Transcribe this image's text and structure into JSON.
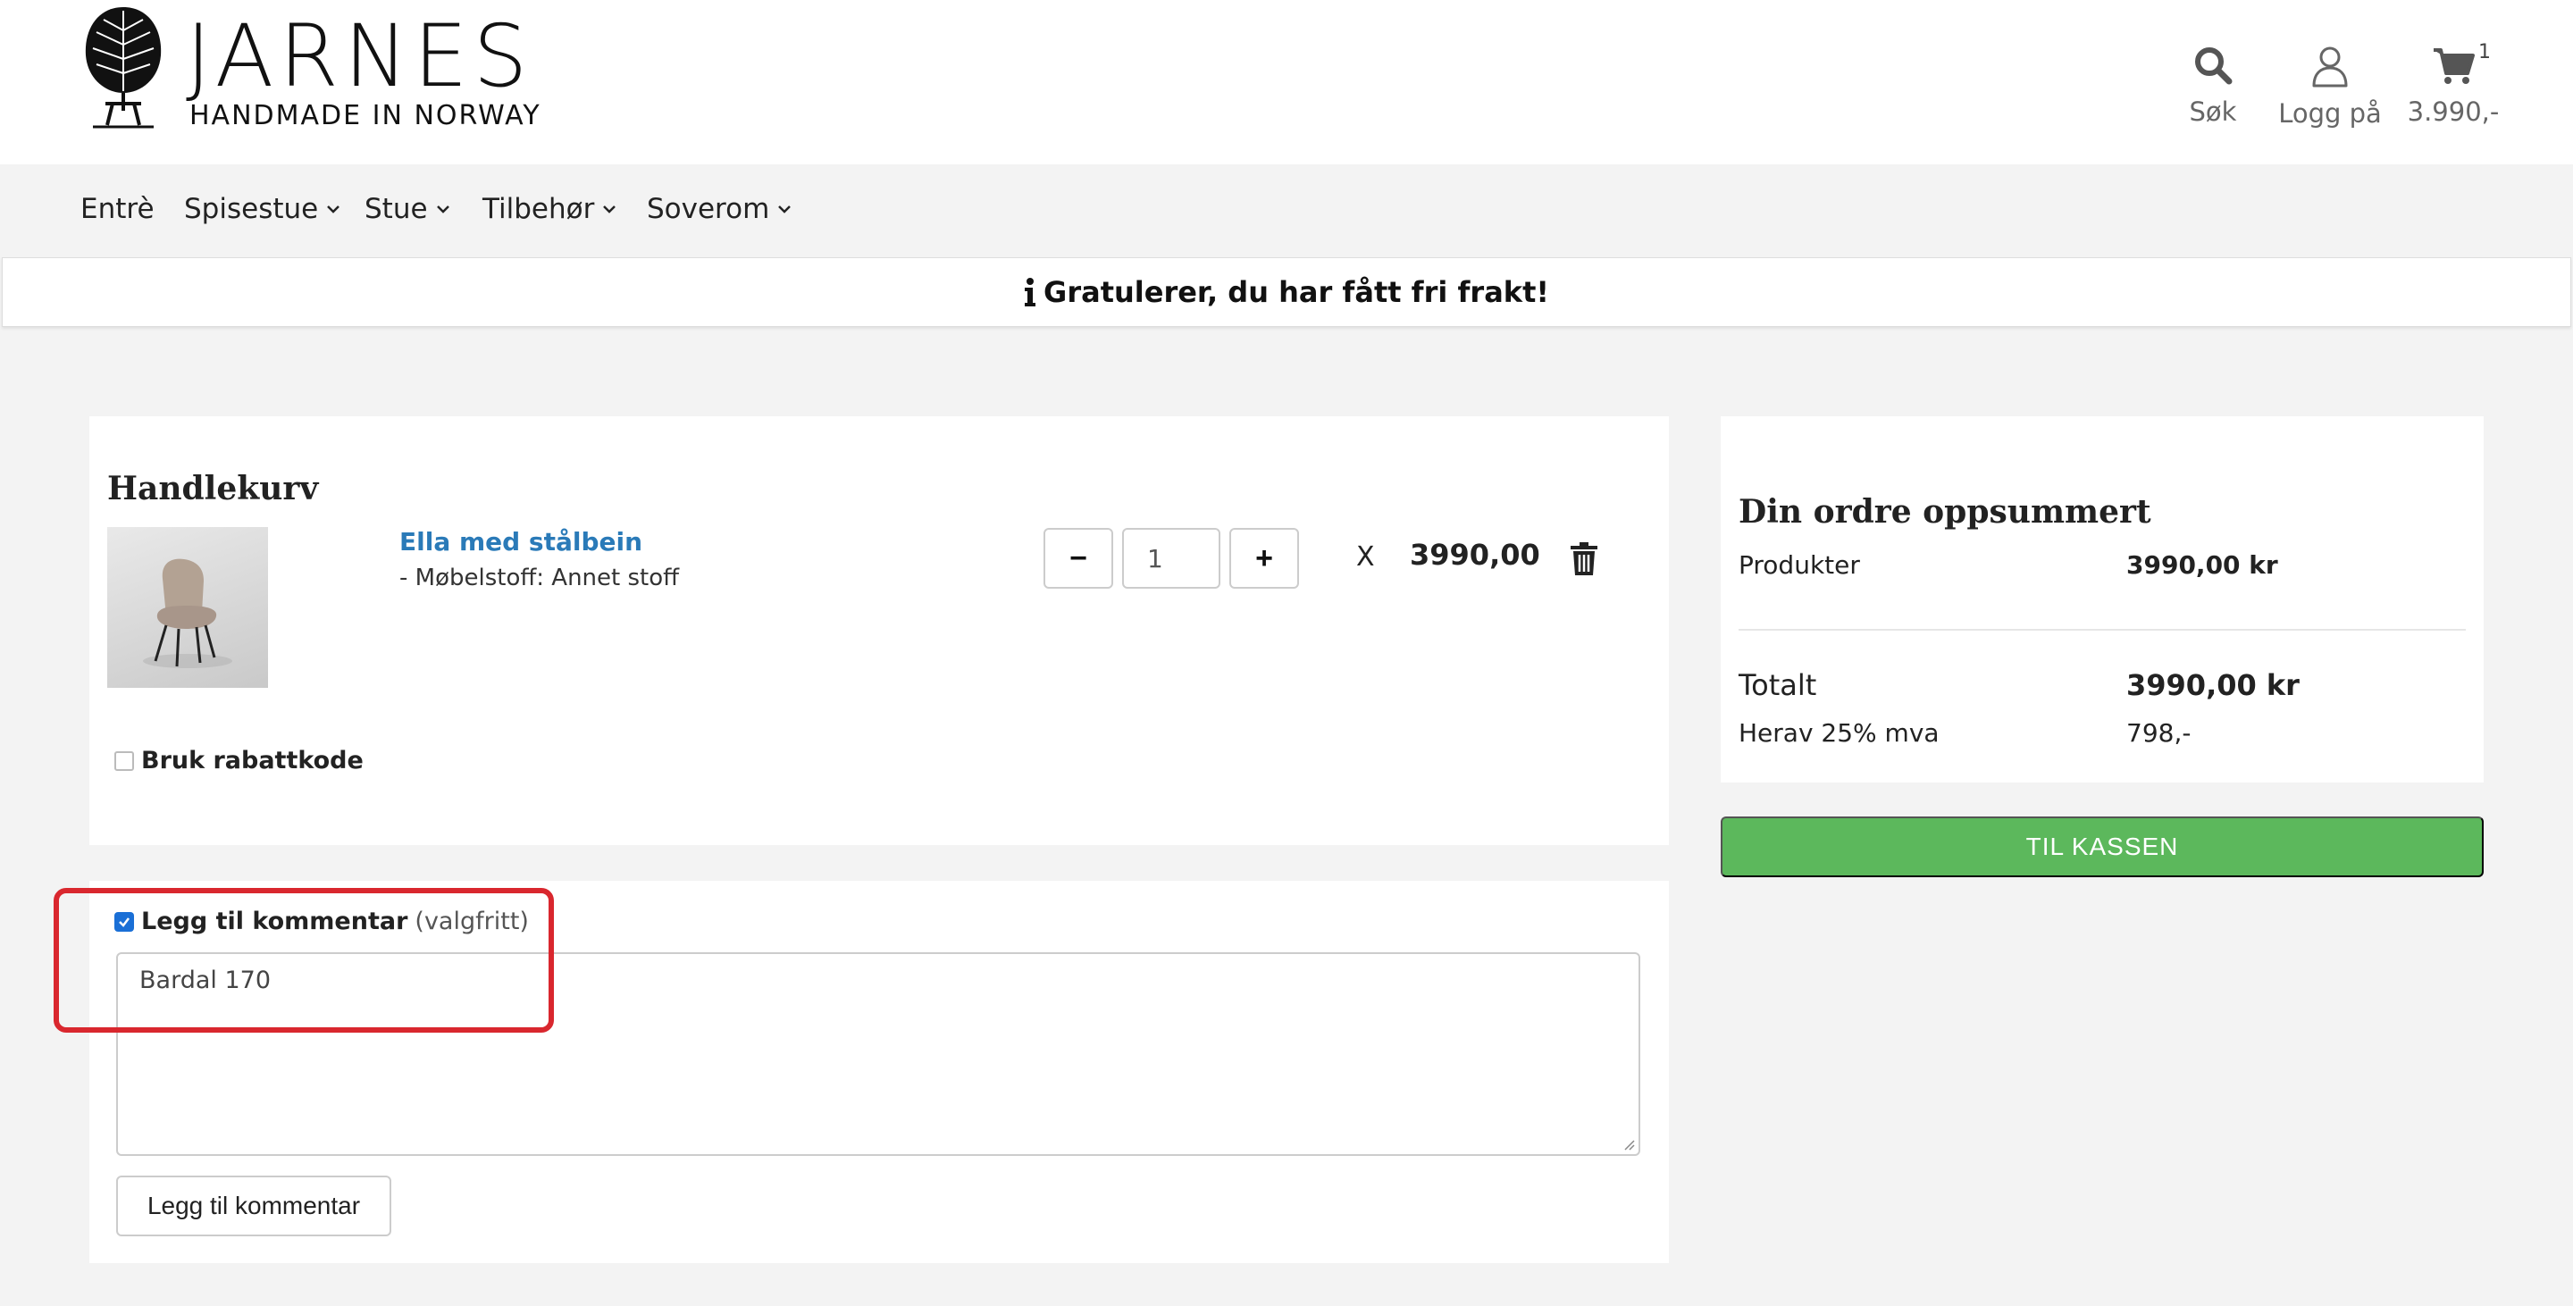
{
  "brand": {
    "name": "JARNES",
    "tagline": "HANDMADE IN NORWAY"
  },
  "header": {
    "search_label": "Søk",
    "login_label": "Logg på",
    "cart_total": "3.990,-",
    "cart_count": "1"
  },
  "nav": {
    "items": [
      {
        "label": "Entrè"
      },
      {
        "label": "Spisestue"
      },
      {
        "label": "Stue"
      },
      {
        "label": "Tilbehør"
      },
      {
        "label": "Soverom"
      }
    ]
  },
  "banner": {
    "text": "Gratulerer, du har fått fri frakt!"
  },
  "cart": {
    "title": "Handlekurv",
    "item": {
      "name": "Ella med stålbein",
      "variant": "- Møbelstoff: Annet stoff",
      "quantity": "1",
      "minus_label": "−",
      "plus_label": "+",
      "times": "X",
      "price": "3990,00"
    },
    "discount_label": "Bruk rabattkode"
  },
  "comment": {
    "checkbox_label": "Legg til kommentar",
    "optional_label": "(valgfritt)",
    "value": "Bardal 170",
    "button_label": "Legg til kommentar"
  },
  "summary": {
    "title": "Din ordre oppsummert",
    "products_label": "Produkter",
    "products_value": "3990,00 kr",
    "total_label": "Totalt",
    "total_value": "3990,00 kr",
    "vat_label": "Herav 25% mva",
    "vat_value": "798,-",
    "checkout_label": "TIL KASSEN"
  },
  "colors": {
    "link": "#2a7ab8",
    "checkout": "#5cb85c",
    "highlight": "#d9272e",
    "checkbox": "#1a6fd6"
  }
}
